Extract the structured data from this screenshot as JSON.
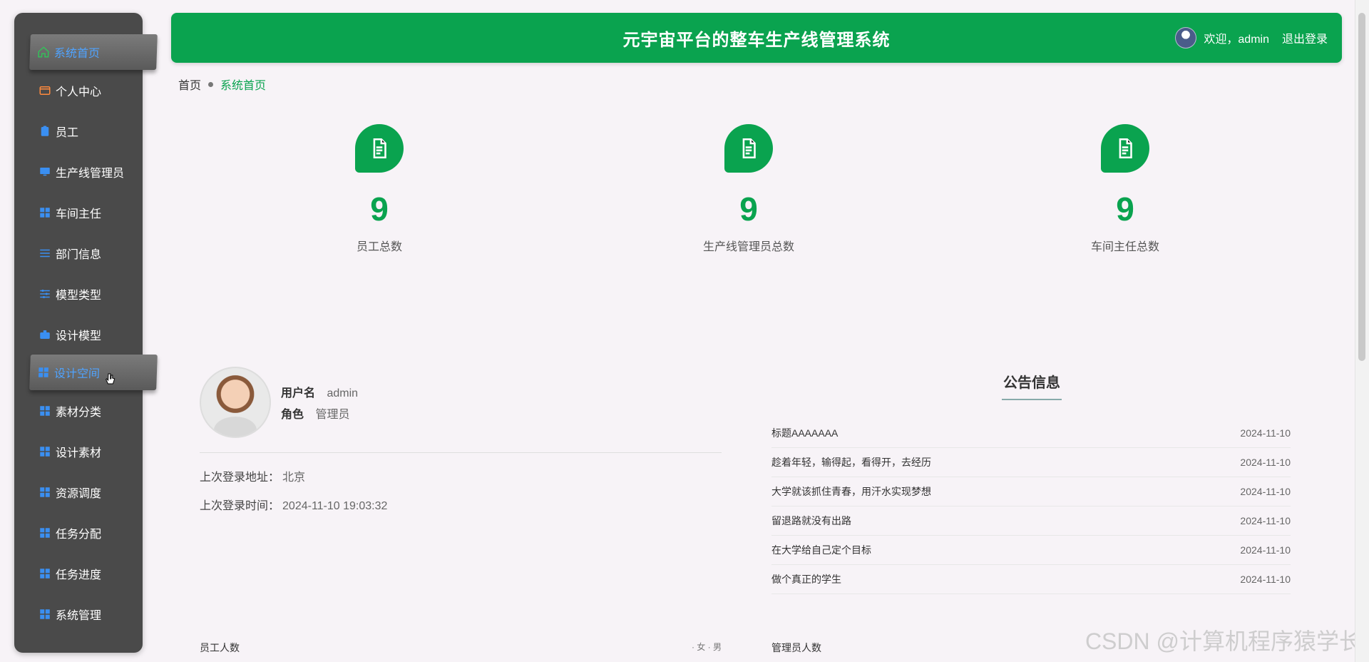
{
  "sidebar": {
    "items": [
      {
        "label": "系统首页"
      },
      {
        "label": "个人中心"
      },
      {
        "label": "员工"
      },
      {
        "label": "生产线管理员"
      },
      {
        "label": "车间主任"
      },
      {
        "label": "部门信息"
      },
      {
        "label": "模型类型"
      },
      {
        "label": "设计模型"
      },
      {
        "label": "设计空间"
      },
      {
        "label": "素材分类"
      },
      {
        "label": "设计素材"
      },
      {
        "label": "资源调度"
      },
      {
        "label": "任务分配"
      },
      {
        "label": "任务进度"
      },
      {
        "label": "系统管理"
      }
    ]
  },
  "header": {
    "title": "元宇宙平台的整车生产线管理系统",
    "welcome": "欢迎，admin",
    "logout": "退出登录"
  },
  "breadcrumb": {
    "home": "首页",
    "current": "系统首页"
  },
  "stats": [
    {
      "value": "9",
      "label": "员工总数"
    },
    {
      "value": "9",
      "label": "生产线管理员总数"
    },
    {
      "value": "9",
      "label": "车间主任总数"
    }
  ],
  "user": {
    "username_label": "用户名",
    "username": "admin",
    "role_label": "角色",
    "role": "管理员",
    "last_login_addr_label": "上次登录地址：",
    "last_login_addr": "北京",
    "last_login_time_label": "上次登录时间：",
    "last_login_time": "2024-11-10 19:03:32"
  },
  "notice": {
    "title": "公告信息",
    "items": [
      {
        "title": "标题AAAAAAA",
        "date": "2024-11-10"
      },
      {
        "title": "趁着年轻，输得起，看得开，去经历",
        "date": "2024-11-10"
      },
      {
        "title": "大学就该抓住青春，用汗水实现梦想",
        "date": "2024-11-10"
      },
      {
        "title": "留退路就没有出路",
        "date": "2024-11-10"
      },
      {
        "title": "在大学给自己定个目标",
        "date": "2024-11-10"
      },
      {
        "title": "做个真正的学生",
        "date": "2024-11-10"
      }
    ]
  },
  "charts": {
    "employee_title": "员工人数",
    "employee_legend": "· 女 · 男",
    "admin_title": "管理员人数"
  },
  "watermark": "CSDN @计算机程序猿学长",
  "colors": {
    "green": "#0aa34f",
    "sidebar": "#4a4a4a",
    "active_text": "#3a8ff2"
  }
}
